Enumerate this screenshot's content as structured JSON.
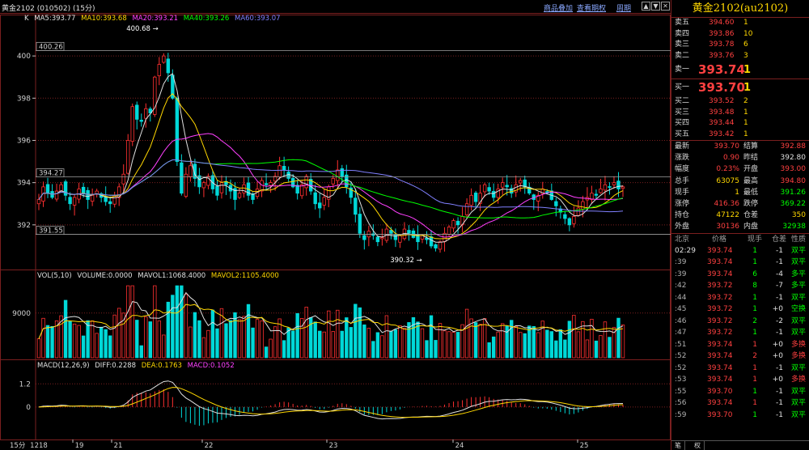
{
  "topbar": {
    "title": "黄金2102 (010502) (15分)",
    "overlay_link": "商品叠加",
    "options_link": "查看期权",
    "period_link": "周期",
    "btn_up": "▲",
    "btn_down": "▼",
    "btn_close": "✕"
  },
  "legend_k": {
    "k": "K",
    "ma5": "MA5:393.77",
    "ma10": "MA10:393.68",
    "ma20": "MA20:393.21",
    "ma40": "MA40:393.26",
    "ma60": "MA60:393.07"
  },
  "legend_vol": {
    "name": "VOL(5,10)",
    "volume": "VOLUME:0.0000",
    "mavol1": "MAVOL1:1068.4000",
    "mavol2": "MAVOL2:1105.4000"
  },
  "legend_macd": {
    "name": "MACD(12,26,9)",
    "diff": "DIFF:0.2288",
    "dea": "DEA:0.1763",
    "macd": "MACD:0.1052"
  },
  "annotations": {
    "high_box": "400.26",
    "low_box": "391.55",
    "mid_box": "394.27",
    "high_label": "400.68",
    "low_label": "390.32"
  },
  "colors": {
    "up": "#ff3030",
    "down": "#00d8d8",
    "ma5": "#e0e0e0",
    "ma10": "#ffd700",
    "ma20": "#ff40ff",
    "ma40": "#00ff00",
    "ma60": "#8080ff",
    "grid": "#7a1f1f"
  },
  "chart_data": {
    "type": "candlestick",
    "price_axis": {
      "ticks": [
        400,
        398,
        396,
        394,
        392
      ],
      "ylim": [
        390,
        401.5
      ]
    },
    "vol_axis": {
      "ticks": [
        9000
      ],
      "ylim": [
        0,
        15000
      ]
    },
    "macd_axis": {
      "ticks": [
        1.2,
        0
      ],
      "ylim": [
        -1.6,
        1.8
      ]
    },
    "x_labels": [
      "15分",
      "1218",
      "19",
      "21",
      "22",
      "23",
      "24",
      "25"
    ],
    "series_names": [
      "MA5",
      "MA10",
      "MA20",
      "MA40",
      "MA60",
      "VOLUME",
      "MAVOL1",
      "MAVOL2",
      "DIFF",
      "DEA",
      "MACD"
    ],
    "close_path": [
      393.2,
      393.8,
      393.5,
      393.3,
      393.6,
      393.9,
      393.4,
      393.0,
      393.3,
      393.7,
      393.5,
      393.2,
      393.4,
      393.6,
      393.3,
      393.1,
      393.0,
      393.4,
      393.8,
      394.4,
      396.0,
      397.6,
      397.0,
      396.9,
      397.5,
      397.3,
      399.0,
      399.6,
      400.0,
      399.2,
      398.0,
      395.0,
      393.5,
      394.4,
      394.8,
      394.2,
      393.8,
      394.0,
      394.3,
      393.7,
      393.4,
      394.0,
      393.9,
      393.6,
      393.2,
      393.5,
      393.9,
      393.4,
      393.2,
      393.7,
      394.1,
      393.9,
      394.0,
      394.3,
      394.8,
      394.6,
      394.2,
      393.8,
      393.5,
      393.9,
      394.3,
      393.6,
      393.0,
      392.8,
      393.3,
      393.8,
      394.2,
      394.6,
      394.3,
      393.8,
      393.3,
      392.5,
      391.6,
      391.3,
      391.7,
      391.5,
      391.2,
      391.4,
      391.8,
      391.6,
      391.3,
      391.5,
      391.8,
      391.6,
      391.4,
      391.2,
      391.5,
      391.3,
      391.0,
      390.9,
      391.2,
      391.6,
      391.9,
      392.2,
      392.0,
      392.4,
      393.0,
      393.4,
      393.1,
      393.5,
      393.9,
      393.6,
      393.3,
      393.7,
      394.0,
      393.8,
      393.5,
      393.9,
      394.1,
      393.8,
      393.5,
      393.2,
      393.4,
      393.7,
      393.5,
      393.2,
      392.9,
      392.6,
      392.3,
      392.0,
      392.4,
      392.8,
      393.1,
      393.3,
      393.5,
      393.4,
      393.7,
      393.9,
      393.8,
      394.0,
      393.7,
      393.8
    ]
  },
  "side": {
    "title": "黄金2102(au2102)",
    "asks": [
      {
        "label": "卖五",
        "price": "394.60",
        "vol": "1"
      },
      {
        "label": "卖四",
        "price": "393.86",
        "vol": "10"
      },
      {
        "label": "卖三",
        "price": "393.78",
        "vol": "6"
      },
      {
        "label": "卖二",
        "price": "393.76",
        "vol": "3"
      }
    ],
    "ask1": {
      "label": "卖一",
      "price": "393.74",
      "vol": "1"
    },
    "bid1": {
      "label": "买一",
      "price": "393.70",
      "vol": "1"
    },
    "bids": [
      {
        "label": "买二",
        "price": "393.52",
        "vol": "2"
      },
      {
        "label": "买三",
        "price": "393.48",
        "vol": "1"
      },
      {
        "label": "买四",
        "price": "393.44",
        "vol": "1"
      },
      {
        "label": "买五",
        "price": "393.42",
        "vol": "1"
      }
    ],
    "quotes": [
      {
        "l1": "最新",
        "v1": "393.70",
        "c1": "red",
        "l2": "结算",
        "v2": "392.88",
        "c2": "red"
      },
      {
        "l1": "涨跌",
        "v1": "0.90",
        "c1": "red",
        "l2": "昨结",
        "v2": "392.80",
        "c2": "white"
      },
      {
        "l1": "幅度",
        "v1": "0.23%",
        "c1": "red",
        "l2": "开盘",
        "v2": "393.00",
        "c2": "red"
      },
      {
        "l1": "总手",
        "v1": "63075",
        "c1": "yellow",
        "l2": "最高",
        "v2": "394.80",
        "c2": "red"
      },
      {
        "l1": "现手",
        "v1": "1",
        "c1": "yellow",
        "l2": "最低",
        "v2": "391.26",
        "c2": "green"
      },
      {
        "l1": "涨停",
        "v1": "416.36",
        "c1": "red",
        "l2": "跌停",
        "v2": "369.22",
        "c2": "green"
      },
      {
        "l1": "持仓",
        "v1": "47122",
        "c1": "yellow",
        "l2": "仓差",
        "v2": "350",
        "c2": "yellow"
      },
      {
        "l1": "外盘",
        "v1": "30136",
        "c1": "red",
        "l2": "内盘",
        "v2": "32938",
        "c2": "green"
      }
    ],
    "ticks_header": {
      "c1": "北京",
      "c2": "价格",
      "c3": "现手",
      "c4": "仓差",
      "c5": "性质"
    },
    "ticks": [
      {
        "time": "02:29",
        "price": "393.74",
        "vol": "1",
        "oi": "-1",
        "nature": "双平",
        "vc": "green",
        "oc": "white",
        "nc": "green",
        "tc": "white"
      },
      {
        "time": ":39",
        "price": "393.74",
        "vol": "1",
        "oi": "-1",
        "nature": "双平",
        "vc": "green",
        "oc": "white",
        "nc": "green",
        "tc": "grey"
      },
      {
        "time": ":39",
        "price": "393.74",
        "vol": "6",
        "oi": "-4",
        "nature": "多平",
        "vc": "green",
        "oc": "white",
        "nc": "green",
        "tc": "grey"
      },
      {
        "time": ":42",
        "price": "393.72",
        "vol": "8",
        "oi": "-7",
        "nature": "多平",
        "vc": "green",
        "oc": "white",
        "nc": "green",
        "tc": "grey"
      },
      {
        "time": ":44",
        "price": "393.72",
        "vol": "1",
        "oi": "-1",
        "nature": "双平",
        "vc": "green",
        "oc": "white",
        "nc": "green",
        "tc": "grey"
      },
      {
        "time": ":45",
        "price": "393.72",
        "vol": "1",
        "oi": "+0",
        "nature": "空换",
        "vc": "green",
        "oc": "white",
        "nc": "green",
        "tc": "grey"
      },
      {
        "time": ":46",
        "price": "393.72",
        "vol": "2",
        "oi": "-2",
        "nature": "双平",
        "vc": "green",
        "oc": "white",
        "nc": "green",
        "tc": "grey"
      },
      {
        "time": ":47",
        "price": "393.72",
        "vol": "1",
        "oi": "-1",
        "nature": "双平",
        "vc": "green",
        "oc": "white",
        "nc": "green",
        "tc": "grey"
      },
      {
        "time": ":51",
        "price": "393.74",
        "vol": "1",
        "oi": "+0",
        "nature": "多换",
        "vc": "red",
        "oc": "white",
        "nc": "red",
        "tc": "grey"
      },
      {
        "time": ":52",
        "price": "393.74",
        "vol": "2",
        "oi": "+0",
        "nature": "多换",
        "vc": "red",
        "oc": "white",
        "nc": "red",
        "tc": "grey"
      },
      {
        "time": ":52",
        "price": "393.74",
        "vol": "1",
        "oi": "-1",
        "nature": "双平",
        "vc": "red",
        "oc": "white",
        "nc": "green",
        "tc": "grey"
      },
      {
        "time": ":53",
        "price": "393.74",
        "vol": "1",
        "oi": "+0",
        "nature": "多换",
        "vc": "red",
        "oc": "white",
        "nc": "red",
        "tc": "grey"
      },
      {
        "time": ":55",
        "price": "393.70",
        "vol": "1",
        "oi": "-1",
        "nature": "双平",
        "vc": "green",
        "oc": "white",
        "nc": "green",
        "tc": "grey"
      },
      {
        "time": ":56",
        "price": "393.74",
        "vol": "1",
        "oi": "-1",
        "nature": "双平",
        "vc": "red",
        "oc": "white",
        "nc": "green",
        "tc": "grey"
      },
      {
        "time": ":59",
        "price": "393.70",
        "vol": "1",
        "oi": "-1",
        "nature": "双平",
        "vc": "green",
        "oc": "white",
        "nc": "green",
        "tc": "grey"
      }
    ],
    "foot": {
      "tab1": "笔",
      "tab2": "权"
    }
  }
}
